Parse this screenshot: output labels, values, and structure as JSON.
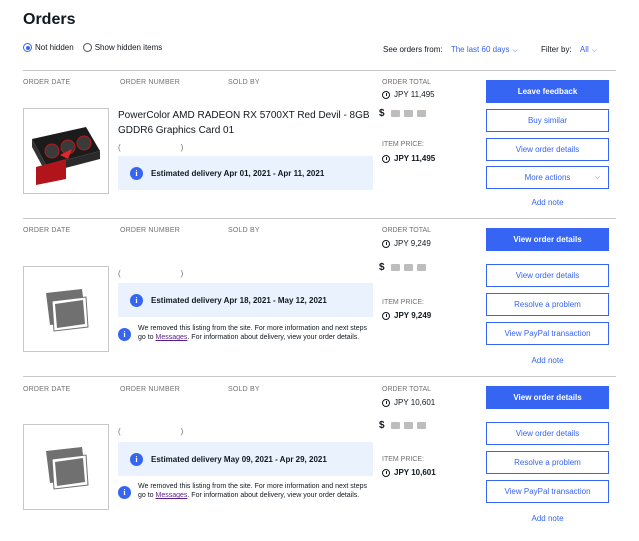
{
  "page": {
    "title": "Orders"
  },
  "visibility": {
    "not_hidden": "Not hidden",
    "show_hidden": "Show hidden items"
  },
  "filters": {
    "see_orders_label": "See orders from:",
    "see_orders_value": "The last 60 days",
    "filter_by_label": "Filter by:",
    "filter_by_value": "All"
  },
  "headers": {
    "order_date": "ORDER DATE",
    "order_number": "ORDER NUMBER",
    "sold_by": "SOLD BY",
    "order_total": "ORDER TOTAL",
    "item_price": "ITEM PRICE:"
  },
  "orders": [
    {
      "title": "PowerColor AMD RADEON RX 5700XT Red Devil - 8GB GDDR6 Graphics Card 01",
      "seller_open": "(",
      "seller_close": ")",
      "total": "JPY 11,495",
      "item_price": "JPY 11,495",
      "delivery": "Estimated delivery Apr 01, 2021 - Apr 11, 2021",
      "buttons": [
        "Leave feedback",
        "Buy similar",
        "View order details",
        "More actions"
      ],
      "link": "Add note"
    },
    {
      "seller_open": "(",
      "seller_close": ")",
      "total": "JPY 9,249",
      "item_price": "JPY 9,249",
      "delivery": "Estimated delivery Apr 18, 2021 - May 12, 2021",
      "notice_pre": "We removed this listing from the site. For more information and next steps go to ",
      "notice_link": "Messages",
      "notice_post": ". For information about delivery, view your order details.",
      "buttons": [
        "View order details",
        "View order details",
        "Resolve a problem",
        "View PayPal transaction"
      ],
      "link": "Add note"
    },
    {
      "seller_open": "(",
      "seller_close": ")",
      "total": "JPY 10,601",
      "item_price": "JPY 10,601",
      "delivery": "Estimated delivery May 09, 2021 - Apr 29, 2021",
      "notice_pre": "We removed this listing from the site. For more information and next steps go to ",
      "notice_link": "Messages",
      "notice_post": ". For information about delivery, view your order details.",
      "buttons": [
        "View order details",
        "View order details",
        "Resolve a problem",
        "View PayPal transaction"
      ],
      "link": "Add note"
    }
  ],
  "icons": {
    "info": "i",
    "dollar": "$",
    "currency": "currency-clock-icon",
    "chevron": "chevron-down-icon"
  },
  "colors": {
    "accent": "#3665f3",
    "info_bg": "#eaf2fd",
    "link_visited": "#5c1e88"
  }
}
